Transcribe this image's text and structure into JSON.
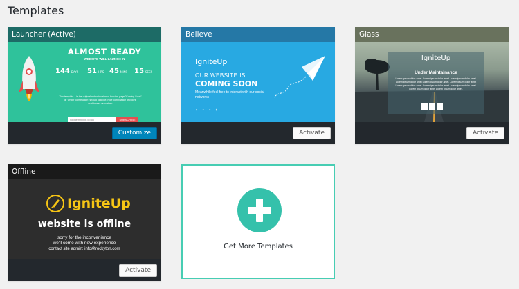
{
  "page": {
    "title": "Templates"
  },
  "colors": {
    "accent": "#0085ba",
    "teal": "#35c1ab",
    "launcher_bg": "#2fc29b",
    "believe_bg": "#28a9e2",
    "offline_logo": "#f6c515"
  },
  "templates": [
    {
      "name": "Launcher (Active)",
      "button": "Customize",
      "preview": {
        "title": "ALMOST READY",
        "subtitle": "WEBSITE WILL LAUNCH IN",
        "countdown": [
          {
            "value": "144",
            "unit": "DAYS"
          },
          {
            "value": "51",
            "unit": "HRS"
          },
          {
            "value": "45",
            "unit": "MINS"
          },
          {
            "value": "15",
            "unit": "SECS"
          }
        ],
        "text": "This template – is the original author's vision of how the page \"Coming Soon\" or \"Under construction\" should look like. Nice combination of colors, unobtrusive animation.",
        "email_placeholder": "yoohem@live.co.uk",
        "subscribe_label": "SUBSCRIBE",
        "icons": [
          "youtube-icon",
          "facebook-icon",
          "linkedin-icon",
          "googleplus-icon",
          "twitter-icon"
        ]
      }
    },
    {
      "name": "Believe",
      "button": "Activate",
      "preview": {
        "logo": "IgniteUp",
        "line1": "OUR WEBSITE IS",
        "line2": "COMING SOON",
        "text": "Meanwhile feel free to interact with our social networks",
        "icons": [
          "twitter-icon",
          "facebook-icon",
          "googleplus-icon",
          "dribbble-icon"
        ]
      }
    },
    {
      "name": "Glass",
      "button": "Activate",
      "preview": {
        "logo": "IgniteUp",
        "title": "Under Maintainance",
        "text": "Lorem ipsum dolor amet. Lorem ipsum dolor amet Lorem ipsum dolor amet. Lorem ipsum dolor amet Lorem ipsum dolor amet. Lorem ipsum dolor amet Lorem ipsum dolor amet. Lorem ipsum dolor amet Lorem ipsum dolor amet. Lorem ipsum dolor amet Lorem ipsum dolor amet.",
        "icons": [
          "twitter-icon",
          "facebook-icon",
          "googleplus-icon"
        ]
      }
    },
    {
      "name": "Offline",
      "button": "Activate",
      "preview": {
        "logo": "IgniteUp",
        "title": "website is offline",
        "line1": "sorry for the inconvenience",
        "line2": "we'll come with new experience",
        "line3": "contact site admin: info@rockyton.com"
      }
    }
  ],
  "more": {
    "label": "Get More Templates",
    "icon": "plus-icon"
  }
}
